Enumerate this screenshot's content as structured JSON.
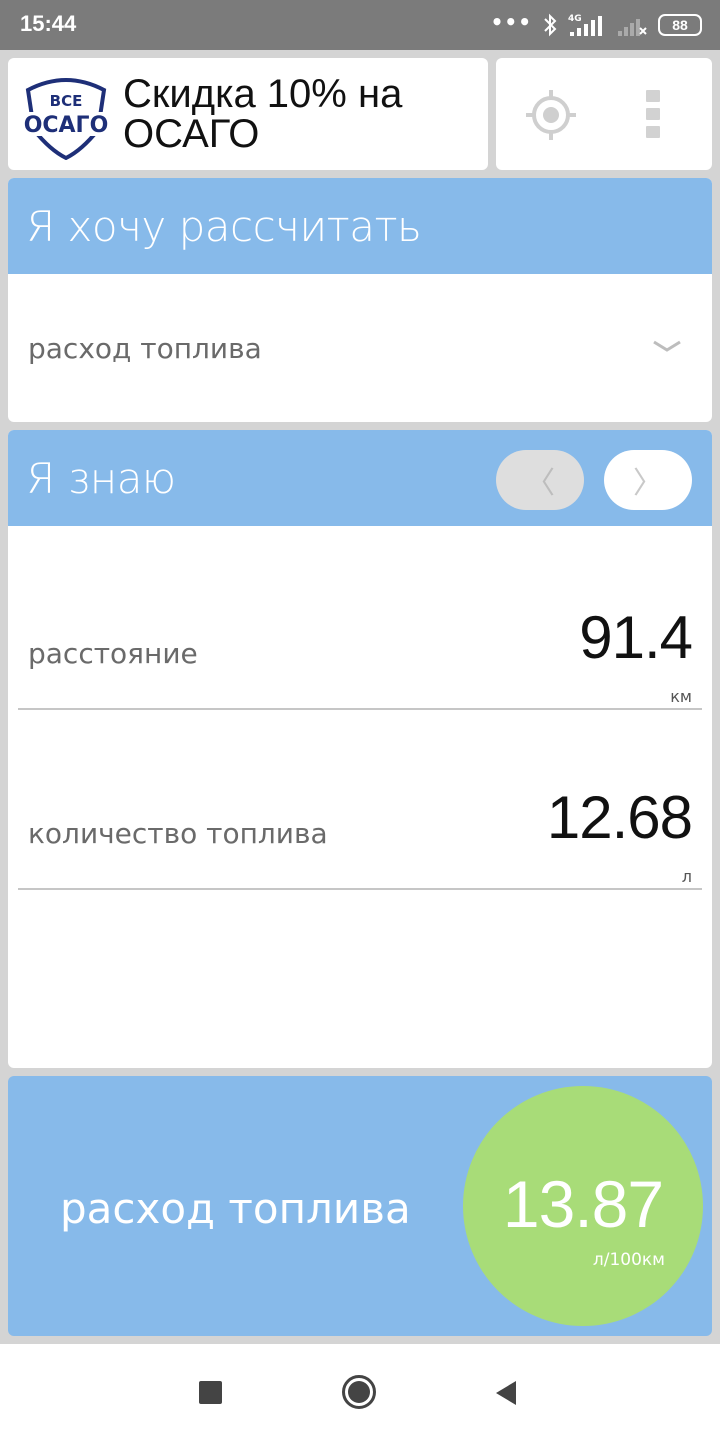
{
  "status_bar": {
    "time": "15:44",
    "dots": "•••",
    "network_label": "4G",
    "battery": "88"
  },
  "ad_banner": {
    "logo_top": "ВСЕ",
    "logo_main": "ОСАГО",
    "text": "Скидка 10% на ОСАГО"
  },
  "toolbar": {
    "locate_icon": "crosshair-icon",
    "menu_icon": "more-vertical-icon"
  },
  "calculate_section": {
    "title": "Я хочу рассчитать",
    "selected": "расход топлива"
  },
  "known_section": {
    "title": "Я знаю",
    "prev_symbol": "〈",
    "next_symbol": "〉",
    "fields": [
      {
        "label": "расстояние",
        "value": "91.4",
        "unit": "км"
      },
      {
        "label": "количество топлива",
        "value": "12.68",
        "unit": "л"
      }
    ]
  },
  "result": {
    "label": "расход топлива",
    "value": "13.87",
    "unit": "л/100км"
  },
  "colors": {
    "header_blue": "#87baea",
    "result_green": "#a8dc78",
    "logo_blue": "#1e2f78"
  }
}
